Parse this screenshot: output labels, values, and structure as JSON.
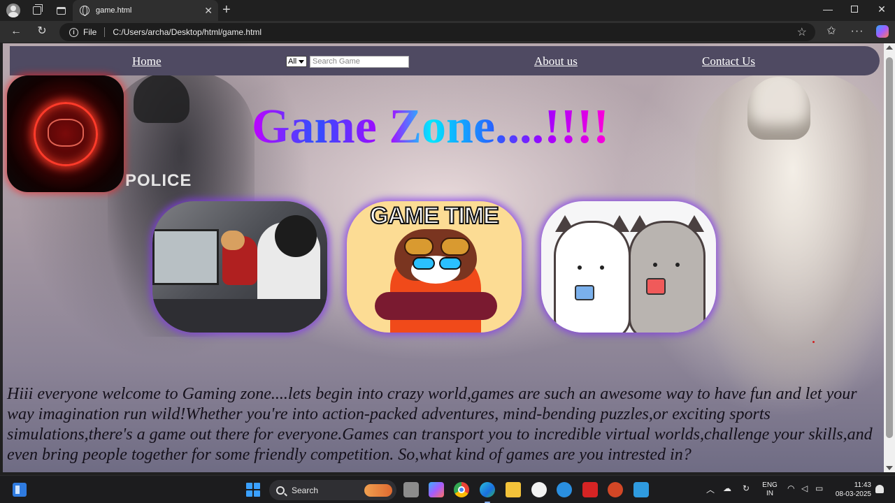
{
  "browser": {
    "tab_title": "game.html",
    "file_label": "File",
    "url": "C:/Users/archa/Desktop/html/game.html"
  },
  "nav": {
    "home": "Home",
    "search_select": "All",
    "search_placeholder": "Search Game",
    "about": "About us",
    "contact": "Contact Us"
  },
  "hero": {
    "title": "Game Zone....!!!!",
    "police_text": "POLICE",
    "card2_title": "GAME TIME"
  },
  "welcome_text": "Hiii everyone welcome to Gaming zone....lets begin into crazy world,games are such an awesome way to have fun and let your way imagination run wild!Whether you're into action-packed adventures, mind-bending puzzles,or exciting sports simulations,there's a game out there for everyone.Games can transport you to incredible virtual worlds,challenge your skills,and even bring people together for some friendly competition. So,what kind of games are you intrested in?",
  "taskbar": {
    "search_label": "Search",
    "lang_line1": "ENG",
    "lang_line2": "IN",
    "time": "11:43",
    "date": "08-03-2025"
  },
  "colors": {
    "navbar": "#4f4a62",
    "card_glow": "#823ce6",
    "logo_glow": "#ff1e1e"
  }
}
